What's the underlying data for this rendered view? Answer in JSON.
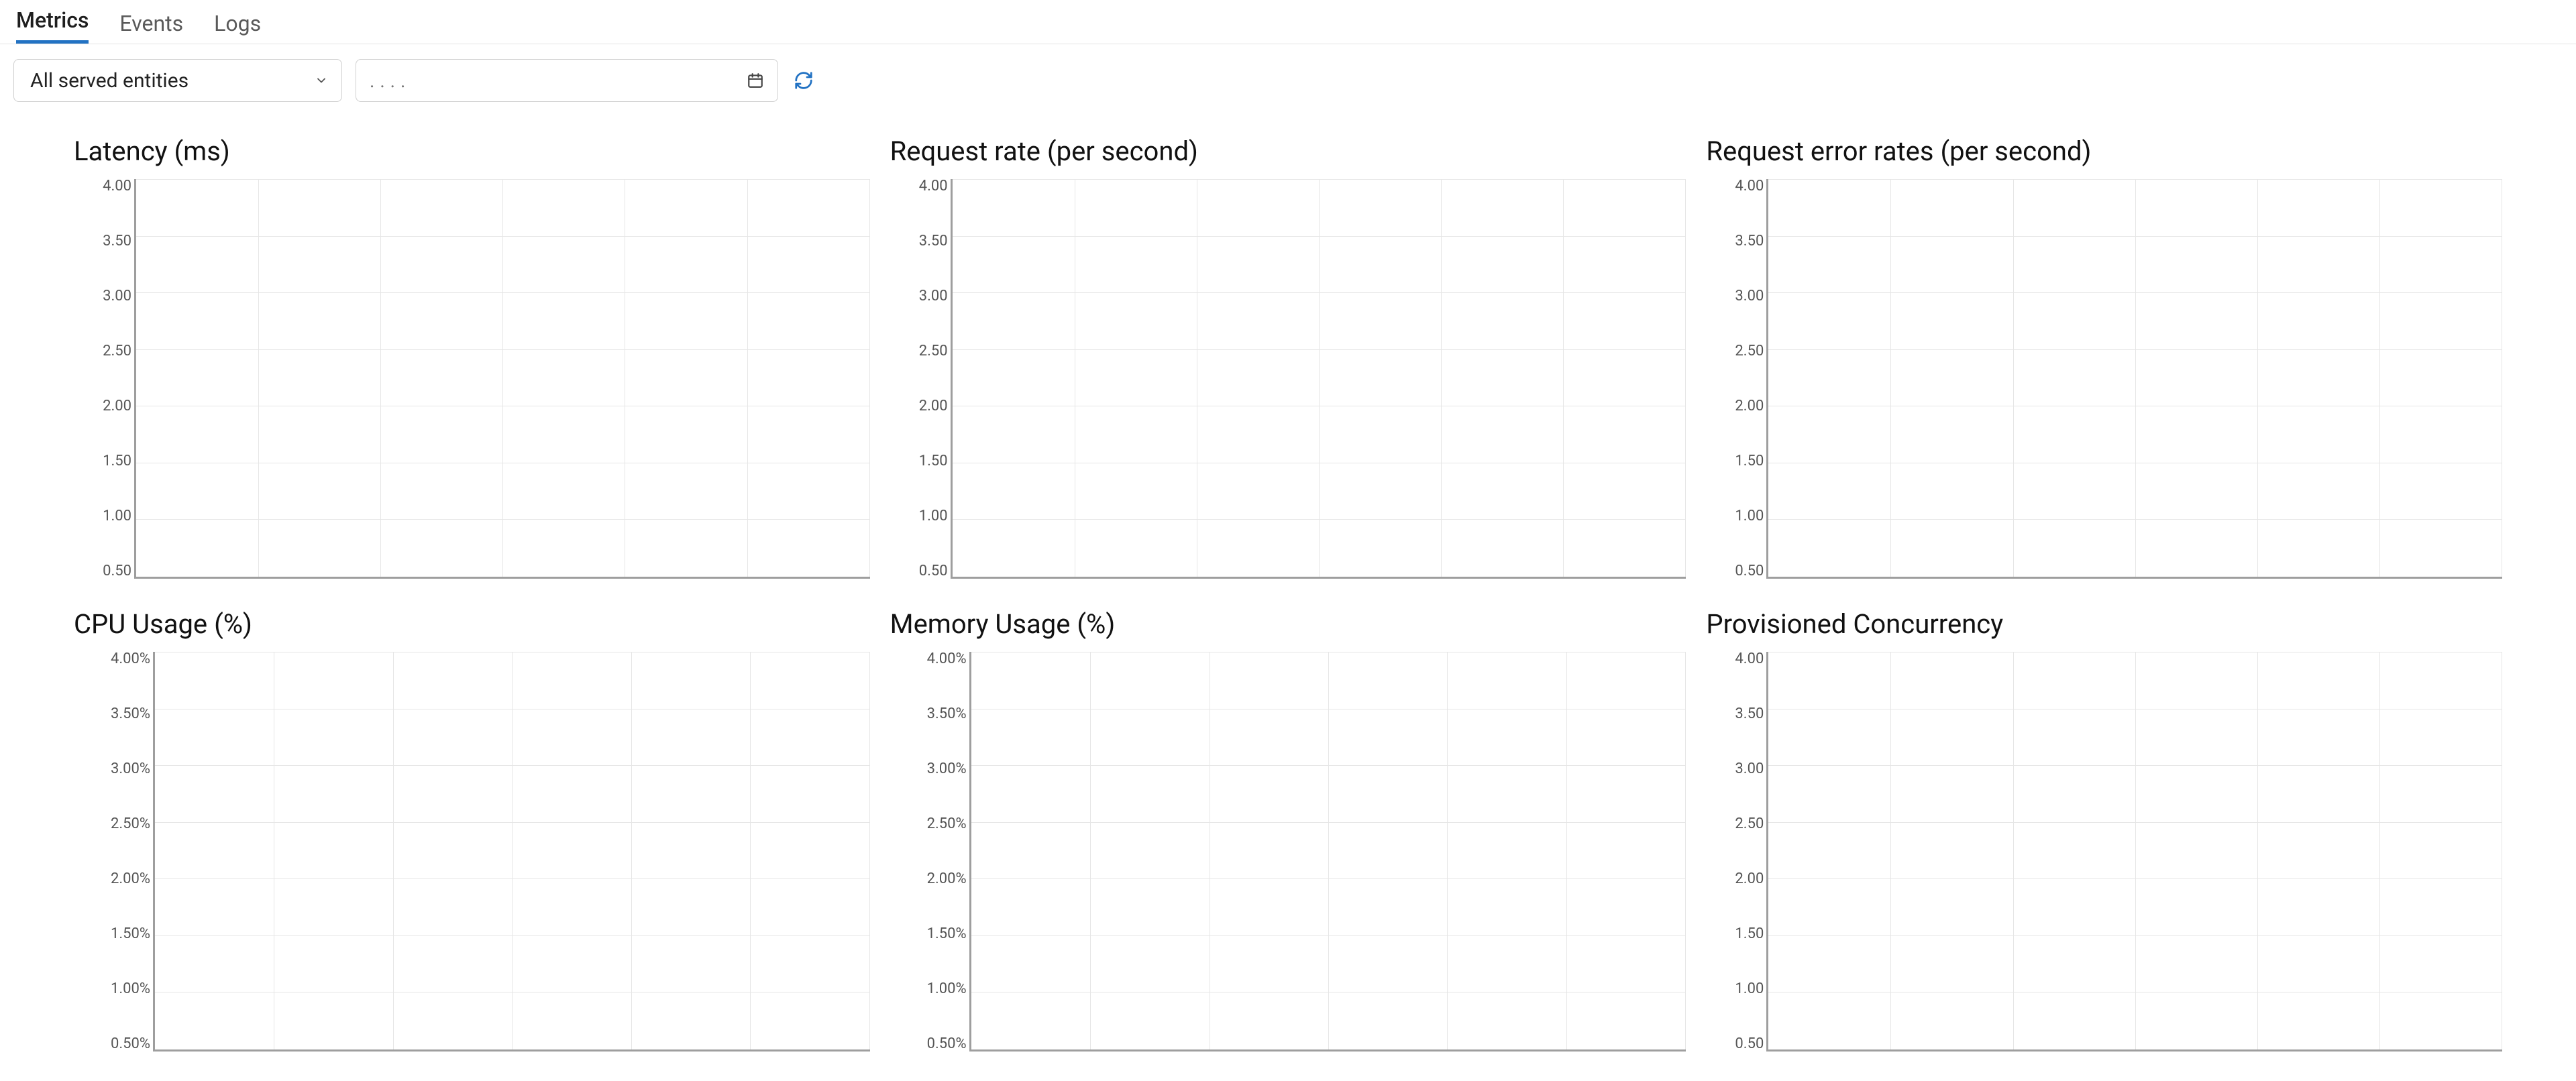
{
  "tabs": [
    {
      "id": "metrics",
      "label": "Metrics",
      "active": true
    },
    {
      "id": "events",
      "label": "Events",
      "active": false
    },
    {
      "id": "logs",
      "label": "Logs",
      "active": false
    }
  ],
  "toolbar": {
    "entity_select": {
      "value": "All served entities"
    },
    "date_range": {
      "value": ". .          . ."
    },
    "refresh_tooltip": "Refresh"
  },
  "chart_data": [
    {
      "id": "latency",
      "title": "Latency (ms)",
      "type": "line",
      "yticks": [
        "4.00",
        "3.50",
        "3.00",
        "2.50",
        "2.00",
        "1.50",
        "1.00",
        "0.50"
      ],
      "ylim": [
        0,
        4.0
      ],
      "series": [],
      "vgrid_count": 7
    },
    {
      "id": "request-rate",
      "title": "Request rate (per second)",
      "type": "line",
      "yticks": [
        "4.00",
        "3.50",
        "3.00",
        "2.50",
        "2.00",
        "1.50",
        "1.00",
        "0.50"
      ],
      "ylim": [
        0,
        4.0
      ],
      "series": [],
      "vgrid_count": 7
    },
    {
      "id": "request-error-rates",
      "title": "Request error rates (per second)",
      "type": "line",
      "yticks": [
        "4.00",
        "3.50",
        "3.00",
        "2.50",
        "2.00",
        "1.50",
        "1.00",
        "0.50"
      ],
      "ylim": [
        0,
        4.0
      ],
      "series": [],
      "vgrid_count": 7
    },
    {
      "id": "cpu-usage",
      "title": "CPU Usage (%)",
      "type": "line",
      "yticks": [
        "4.00%",
        "3.50%",
        "3.00%",
        "2.50%",
        "2.00%",
        "1.50%",
        "1.00%",
        "0.50%"
      ],
      "ylim": [
        0,
        4.0
      ],
      "series": [],
      "vgrid_count": 7
    },
    {
      "id": "memory-usage",
      "title": "Memory Usage (%)",
      "type": "line",
      "yticks": [
        "4.00%",
        "3.50%",
        "3.00%",
        "2.50%",
        "2.00%",
        "1.50%",
        "1.00%",
        "0.50%"
      ],
      "ylim": [
        0,
        4.0
      ],
      "series": [],
      "vgrid_count": 7
    },
    {
      "id": "provisioned-concurrency",
      "title": "Provisioned Concurrency",
      "type": "line",
      "yticks": [
        "4.00",
        "3.50",
        "3.00",
        "2.50",
        "2.00",
        "1.50",
        "1.00",
        "0.50"
      ],
      "ylim": [
        0,
        4.0
      ],
      "series": [],
      "vgrid_count": 7
    }
  ]
}
